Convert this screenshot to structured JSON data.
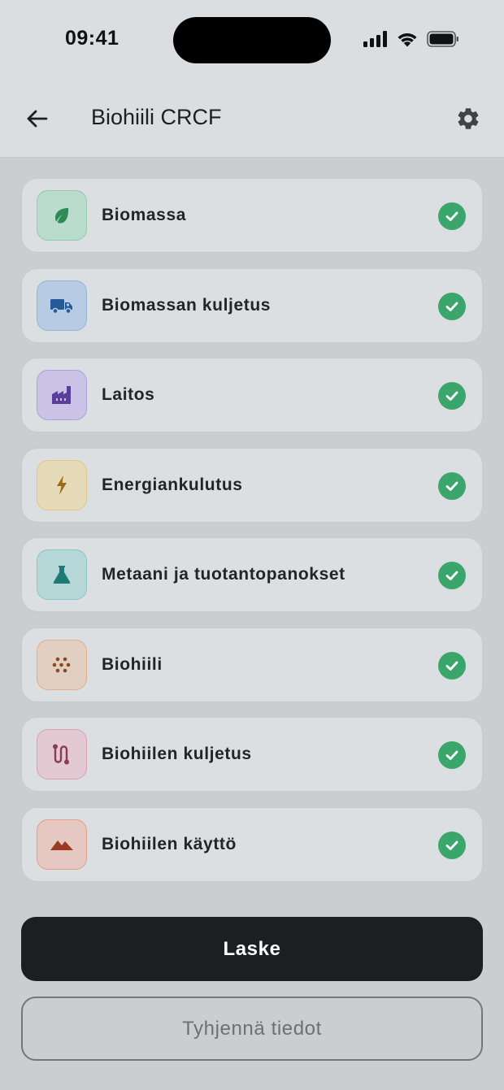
{
  "status_bar": {
    "time": "09:41"
  },
  "app_bar": {
    "title": "Biohiili CRCF",
    "back_icon": "arrow-left-icon",
    "settings_icon": "gear-icon"
  },
  "sections": [
    {
      "label": "Biomassa",
      "icon": "leaf-icon",
      "color": "#2f8a57",
      "bg": "#b9dccc",
      "border": "#8fcaa9",
      "completed": true
    },
    {
      "label": "Biomassan kuljetus",
      "icon": "truck-icon",
      "color": "#245a98",
      "bg": "#b7cbe3",
      "border": "#8fb3db",
      "completed": true
    },
    {
      "label": "Laitos",
      "icon": "factory-icon",
      "color": "#5a3e9c",
      "bg": "#cbc3e6",
      "border": "#ae9ee0",
      "completed": true
    },
    {
      "label": "Energiankulutus",
      "icon": "lightning-icon",
      "color": "#9a6b12",
      "bg": "#e5dbb8",
      "border": "#e3c77f",
      "completed": true
    },
    {
      "label": "Metaani ja tuotantopanokset",
      "icon": "flask-icon",
      "color": "#1d7a74",
      "bg": "#b6d8d8",
      "border": "#86c6c5",
      "completed": true
    },
    {
      "label": "Biohiili",
      "icon": "grain-dots-icon",
      "color": "#8a4a1c",
      "bg": "#e1d0c2",
      "border": "#dfae8a",
      "completed": true
    },
    {
      "label": "Biohiilen kuljetus",
      "icon": "route-icon",
      "color": "#8c3a55",
      "bg": "#e2c9d2",
      "border": "#d9a0b5",
      "completed": true
    },
    {
      "label": "Biohiilen käyttö",
      "icon": "mountains-icon",
      "color": "#9a3a22",
      "bg": "#e5c8c1",
      "border": "#e69c86",
      "completed": true
    }
  ],
  "actions": {
    "calculate": "Laske",
    "clear": "Tyhjennä tiedot"
  },
  "colors": {
    "check": "#3aa66b",
    "primary_button": "#1c1f21"
  }
}
